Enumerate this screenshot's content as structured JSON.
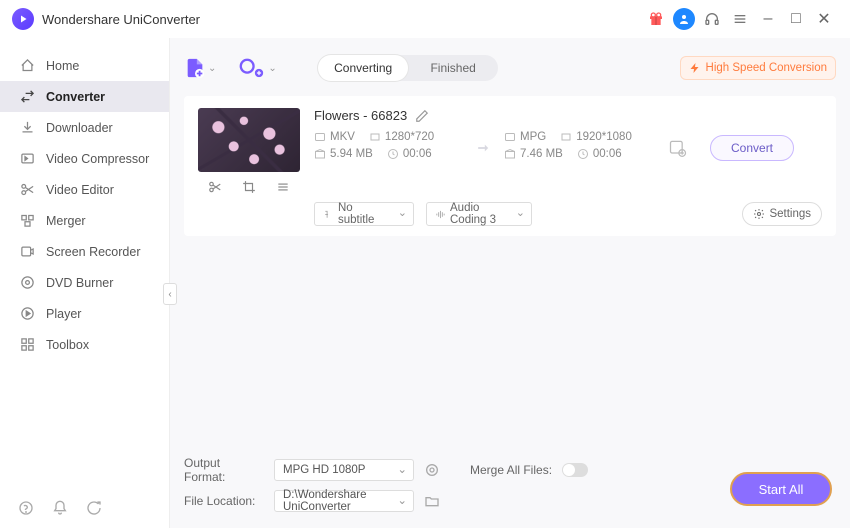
{
  "app": {
    "title": "Wondershare UniConverter"
  },
  "window_controls": {
    "min": "–",
    "max": "□",
    "close": "✕"
  },
  "sidebar": {
    "items": [
      {
        "key": "home",
        "label": "Home"
      },
      {
        "key": "converter",
        "label": "Converter",
        "active": true
      },
      {
        "key": "downloader",
        "label": "Downloader"
      },
      {
        "key": "compressor",
        "label": "Video Compressor"
      },
      {
        "key": "editor",
        "label": "Video Editor"
      },
      {
        "key": "merger",
        "label": "Merger"
      },
      {
        "key": "recorder",
        "label": "Screen Recorder"
      },
      {
        "key": "dvd",
        "label": "DVD Burner"
      },
      {
        "key": "player",
        "label": "Player"
      },
      {
        "key": "toolbox",
        "label": "Toolbox"
      }
    ]
  },
  "tabs": {
    "converting": "Converting",
    "finished": "Finished"
  },
  "hsc": "High Speed Conversion",
  "file": {
    "name": "Flowers - 66823",
    "src": {
      "fmt": "MKV",
      "res": "1280*720",
      "size": "5.94 MB",
      "dur": "00:06"
    },
    "dst": {
      "fmt": "MPG",
      "res": "1920*1080",
      "size": "7.46 MB",
      "dur": "00:06"
    },
    "subtitle": "No subtitle",
    "audio": "Audio Coding 3",
    "settings": "Settings",
    "convert": "Convert"
  },
  "footer": {
    "output_format_label": "Output Format:",
    "output_format": "MPG HD 1080P",
    "file_location_label": "File Location:",
    "file_location": "D:\\Wondershare UniConverter",
    "merge_label": "Merge All Files:",
    "start_all": "Start All"
  }
}
